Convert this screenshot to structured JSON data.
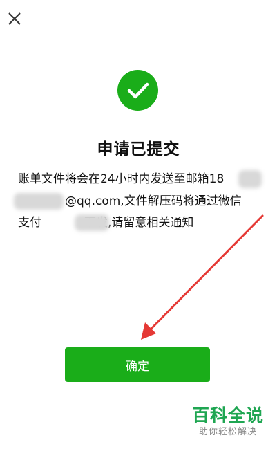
{
  "dialog": {
    "title": "申请已提交",
    "message_line1": "账单文件将会在24小时内发送至邮箱18",
    "message_line2": "@qq.com,文件解压码将通过微信",
    "message_line3_prefix": "支付",
    "message_line3_suffix": "下发,请留意相关通知",
    "confirm_label": "确定"
  },
  "watermark": {
    "main": "百科全说",
    "sub": "助你轻松解决"
  },
  "icons": {
    "close": "close-icon",
    "success": "checkmark-icon"
  },
  "colors": {
    "primary_green": "#1aad19",
    "annotation_arrow": "#e53935",
    "watermark_green": "#1fa652"
  }
}
